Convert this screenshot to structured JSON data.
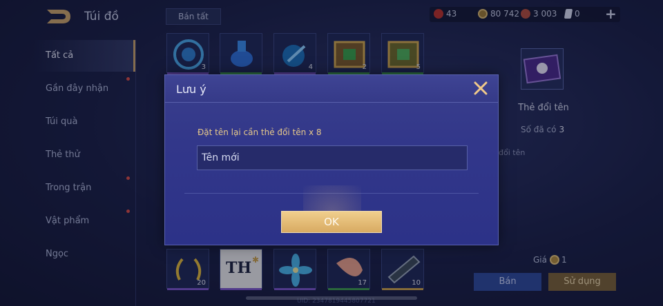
{
  "header": {
    "title": "Túi đồ",
    "sell_all": "Bán tất",
    "currencies": [
      {
        "name": "rubies",
        "value": "43",
        "color": "#c0392b"
      },
      {
        "name": "gold",
        "value": "80 742",
        "color": "#c9a04a"
      },
      {
        "name": "vouchers",
        "value": "3 003",
        "color": "#c75a4a"
      },
      {
        "name": "tickets",
        "value": "0",
        "color": "#c5cbe3"
      }
    ]
  },
  "sidebar": {
    "items": [
      {
        "label": "Tất cả",
        "active": true,
        "dot": false
      },
      {
        "label": "Gần đây nhận",
        "active": false,
        "dot": true
      },
      {
        "label": "Túi quà",
        "active": false,
        "dot": false
      },
      {
        "label": "Thẻ thử",
        "active": false,
        "dot": false
      },
      {
        "label": "Trong trận",
        "active": false,
        "dot": true
      },
      {
        "label": "Vật phẩm",
        "active": false,
        "dot": true
      },
      {
        "label": "Ngọc",
        "active": false,
        "dot": false
      }
    ]
  },
  "grid": {
    "top_counts": [
      "3",
      "",
      "4",
      "2",
      "5"
    ],
    "bottom_counts": [
      "20",
      "",
      "",
      "17",
      "10"
    ],
    "th_label": "TH"
  },
  "detail": {
    "name": "Thẻ đổi tên",
    "owned_label": "Số đã có",
    "owned_value": "3",
    "desc": "đổi tên",
    "price_label": "Giá",
    "price_value": "1",
    "sell_button": "Bán",
    "use_button": "Sử dụng"
  },
  "modal": {
    "title": "Lưu ý",
    "note": "Đặt tên lại cần thẻ đổi tên x 8",
    "input_value": "Tên mới",
    "ok_label": "OK"
  },
  "footer": {
    "uid": "UID: 2347819445807721"
  }
}
